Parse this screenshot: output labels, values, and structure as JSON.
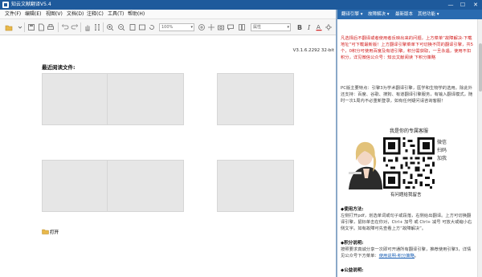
{
  "window": {
    "title": "知云文献翻译V5.4",
    "minimize": "—",
    "maximize": "☐",
    "close": "✕"
  },
  "menu": [
    "文件(F)",
    "编辑(E)",
    "视图(V)",
    "文档(D)",
    "注释(C)",
    "工具(T)",
    "帮助(H)"
  ],
  "toolbar": {
    "zoom_value": "100%",
    "font_value": "属性"
  },
  "start": {
    "version": "V3.1.6.2292 32-bit",
    "recent_title": "最近阅读文件:",
    "open_label": "打开"
  },
  "right_panel": {
    "tabs": [
      "翻译引擎 ▾",
      "故障解决 ▾",
      "最新版本",
      "其他功能 ▾"
    ],
    "notice": "凡选择后不翻译或者使用者反映出来的问题，上方菜单“故障解决-下载地址”可下载最新版！上方翻译引擎菜单下可切换不同的翻译引擎，共5个，0积分可使用百度及有道引擎。积分需获取，一旦永遇，使用不扣积分，详见微信公众号：知云文献阅读 下积分策略",
    "intro": "PC版主要特点：引擎3为学术翻译引擎，医学和生物学的选用。除此外还支持：百度、谷歌、搜狗、有道翻译引擎服务，有输入翻译模式，随时一次1周内不必重新登录，如有任何疑问请咨询客服！",
    "cs_title": "我是你的专属客服",
    "wechat_text": "微信扫码加我",
    "cs_footer": "有问题给我留言",
    "usage_heading": "◆使用方法:",
    "usage_text": "左侧打开pdf，划选单词或句子或段落，右侧给出翻译。上方可切换翻译引擎，鼠标单击在你对，Ctrl+ 加号 或 Ctrl+ 减号 可放大或缩小右侧文字。如有故障可先查看上方“故障解决”。",
    "points_heading": "◆积分说明:",
    "points_text": "按照要求真诚分享一次即可开通所有翻译引擎，推荐使用引擎3，详情见公众号下方菜单：",
    "points_link": "使用说明-积分策略",
    "points_end": "。",
    "welfare_heading": "◆公益说明:"
  },
  "colors": {
    "title_bg": "#1e5a9c",
    "notice_red": "#d21f1f",
    "link_blue": "#1a5fb4"
  }
}
